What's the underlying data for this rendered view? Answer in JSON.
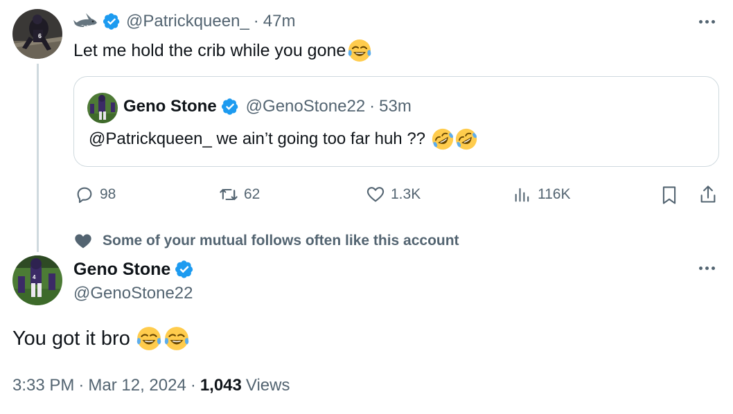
{
  "tweet": {
    "emoji_prefix_icon": "shark-emoji",
    "handle": "@Patrickqueen_",
    "time": "47m",
    "text": "Let me hold the crib while you gone",
    "text_emoji": "face-with-tears-of-joy",
    "quote": {
      "name": "Geno Stone",
      "handle": "@GenoStone22",
      "time": "53m",
      "text": "@Patrickqueen_ we ain’t going too far huh ??",
      "text_emojis": [
        "rolling-on-floor-laughing",
        "rolling-on-floor-laughing"
      ]
    },
    "actions": {
      "replies": "98",
      "reposts": "62",
      "likes": "1.3K",
      "views": "116K"
    }
  },
  "social_context": "Some of your mutual follows often like this account",
  "reply": {
    "name": "Geno Stone",
    "handle": "@GenoStone22",
    "text": "You got it bro",
    "text_emojis": [
      "face-with-tears-of-joy",
      "face-with-tears-of-joy"
    ],
    "time": "3:33 PM",
    "date": "Mar 12, 2024",
    "views_count": "1,043",
    "views_label": "Views"
  },
  "colors": {
    "verified": "#1d9bf0",
    "muted_text": "#536471",
    "border": "#cfd9de",
    "primary_text": "#0f1419"
  }
}
